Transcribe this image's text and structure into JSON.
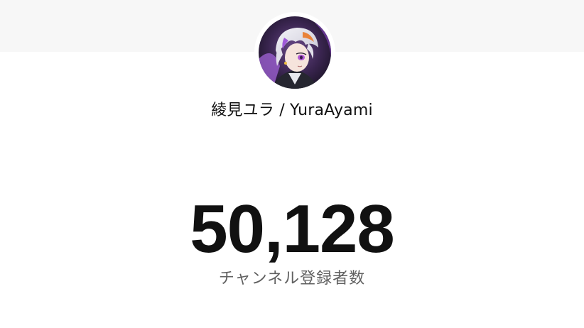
{
  "channel": {
    "name": "綾見ユラ / YuraAyami",
    "avatar_icon": "anime-character-avatar-icon"
  },
  "stats": {
    "subscriber_count": "50,128",
    "subscriber_label": "チャンネル登録者数"
  },
  "colors": {
    "top_band": "#f7f7f7",
    "background": "#ffffff",
    "count_text": "#111111",
    "label_text": "#606060"
  }
}
